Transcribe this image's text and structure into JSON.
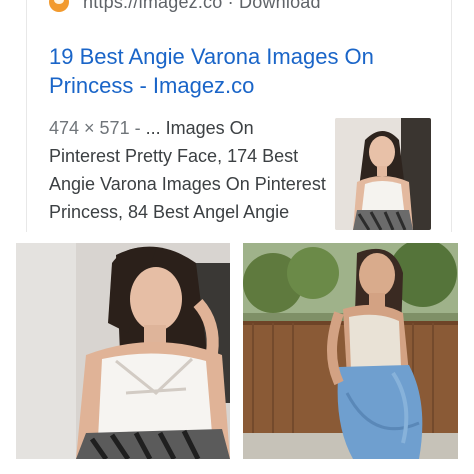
{
  "result": {
    "source_url": "https://imagez.co · Download",
    "title": "19 Best Angie Varona Images On Princess - Imagez.co",
    "snippet_dims": "474 × 571 -",
    "snippet_text": " ... Images On Pinterest Pretty Face, 174 Best Angie Varona Images On Pinterest Princess, 84 Best Angel Angie Varona",
    "favicon_icon": "imagez-favicon-icon",
    "title_color": "#1a65c8"
  },
  "images": [
    {
      "icon": "photo-woman-white-top-icon"
    },
    {
      "icon": "photo-woman-jeans-icon"
    }
  ]
}
